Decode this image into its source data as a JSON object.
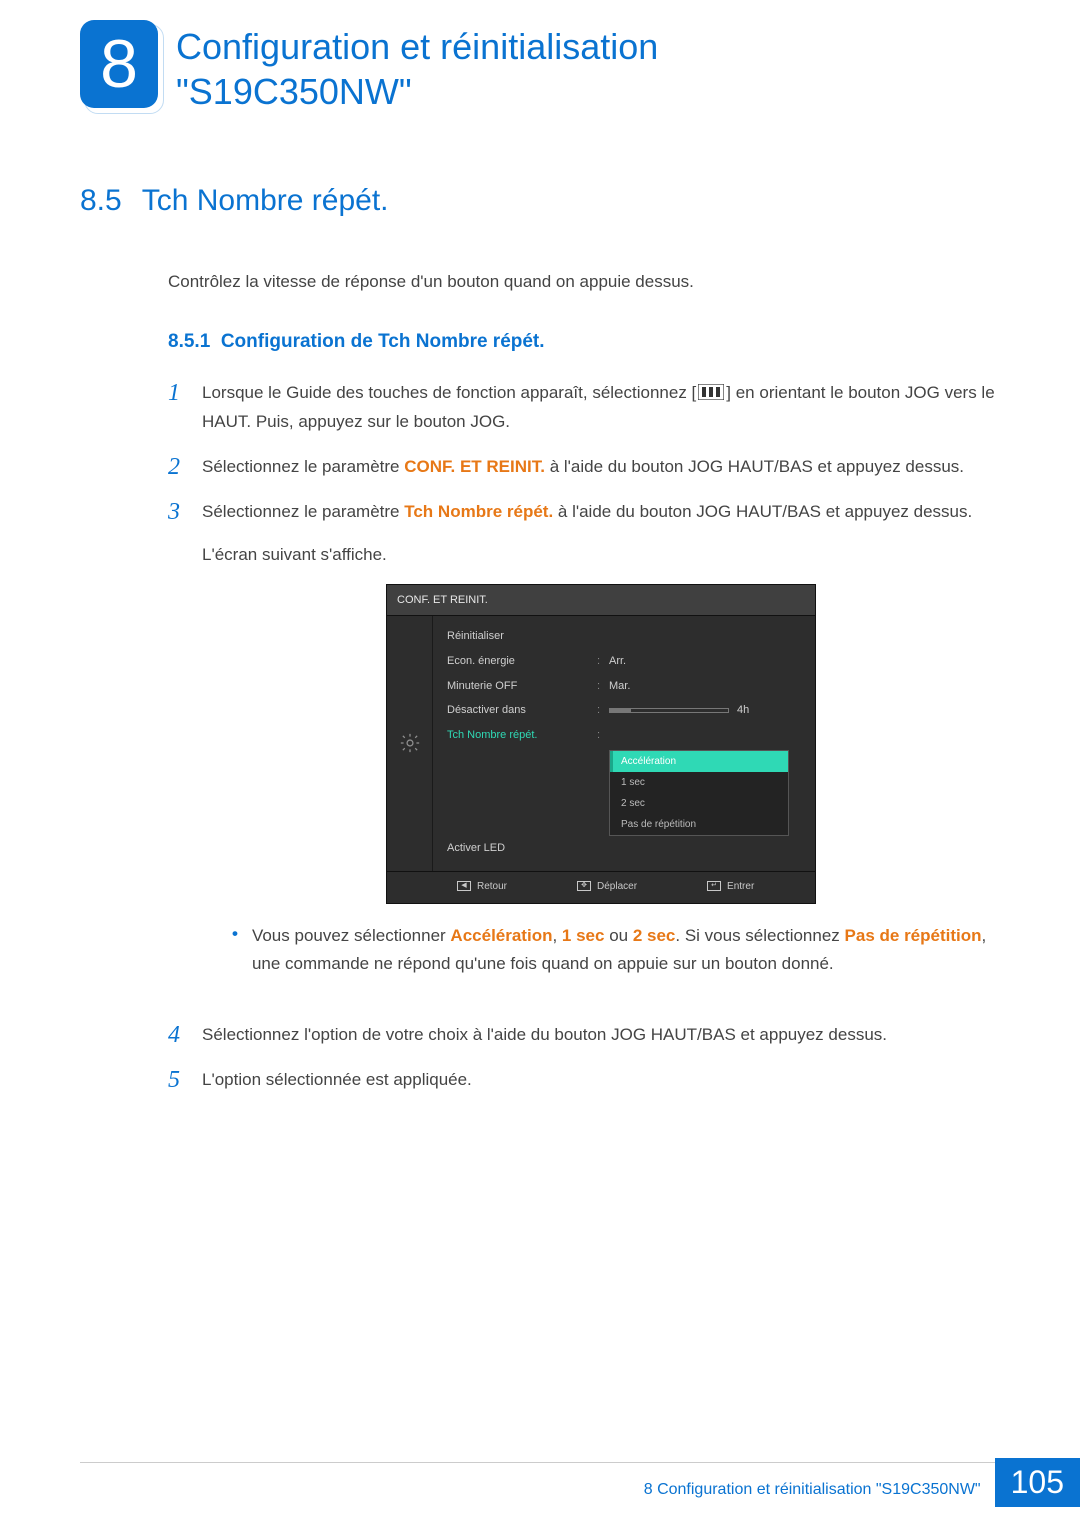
{
  "chapter": {
    "number": "8",
    "title_line1": "Configuration et réinitialisation",
    "title_line2": "\"S19C350NW\""
  },
  "section": {
    "number": "8.5",
    "title": "Tch Nombre répét.",
    "intro": "Contrôlez la vitesse de réponse d'un bouton quand on appuie dessus."
  },
  "subsection": {
    "number": "8.5.1",
    "title": "Configuration de Tch Nombre répét."
  },
  "steps": {
    "s1_a": "Lorsque le Guide des touches de fonction apparaît, sélectionnez [",
    "s1_b": "] en orientant le bouton JOG vers le HAUT. Puis, appuyez sur le bouton JOG.",
    "s2_a": "Sélectionnez le paramètre ",
    "s2_bold": "CONF. ET REINIT.",
    "s2_b": " à l'aide du bouton JOG HAUT/BAS et appuyez dessus.",
    "s3_a": "Sélectionnez le paramètre ",
    "s3_bold": "Tch Nombre répét.",
    "s3_b": " à l'aide du bouton JOG HAUT/BAS et appuyez dessus.",
    "s3_sub": "L'écran suivant s'affiche.",
    "note_a": "Vous pouvez sélectionner ",
    "note_b1": "Accélération",
    "note_c1": ", ",
    "note_b2": "1 sec",
    "note_c2": " ou ",
    "note_b3": "2 sec",
    "note_c3": ". Si vous sélectionnez ",
    "note_b4": "Pas de répétition",
    "note_c4": ", une commande ne répond qu'une fois quand on appuie sur un bouton donné.",
    "s4": "Sélectionnez l'option de votre choix à l'aide du bouton JOG HAUT/BAS et appuyez dessus.",
    "s5": "L'option sélectionnée est appliquée."
  },
  "step_numbers": {
    "n1": "1",
    "n2": "2",
    "n3": "3",
    "n4": "4",
    "n5": "5"
  },
  "osd": {
    "title": "CONF. ET REINIT.",
    "rows": {
      "reinit": "Réinitialiser",
      "econ": "Econ. énergie",
      "econ_val": "Arr.",
      "minut": "Minuterie OFF",
      "minut_val": "Mar.",
      "desact": "Désactiver dans",
      "desact_val": "4h",
      "tch": "Tch Nombre répét.",
      "led": "Activer LED"
    },
    "options": {
      "o1": "Accélération",
      "o2": "1 sec",
      "o3": "2 sec",
      "o4": "Pas de répétition"
    },
    "footer": {
      "retour": "Retour",
      "deplacer": "Déplacer",
      "entrer": "Entrer"
    }
  },
  "footer": {
    "text": "8 Configuration et réinitialisation \"S19C350NW\"",
    "page": "105"
  }
}
